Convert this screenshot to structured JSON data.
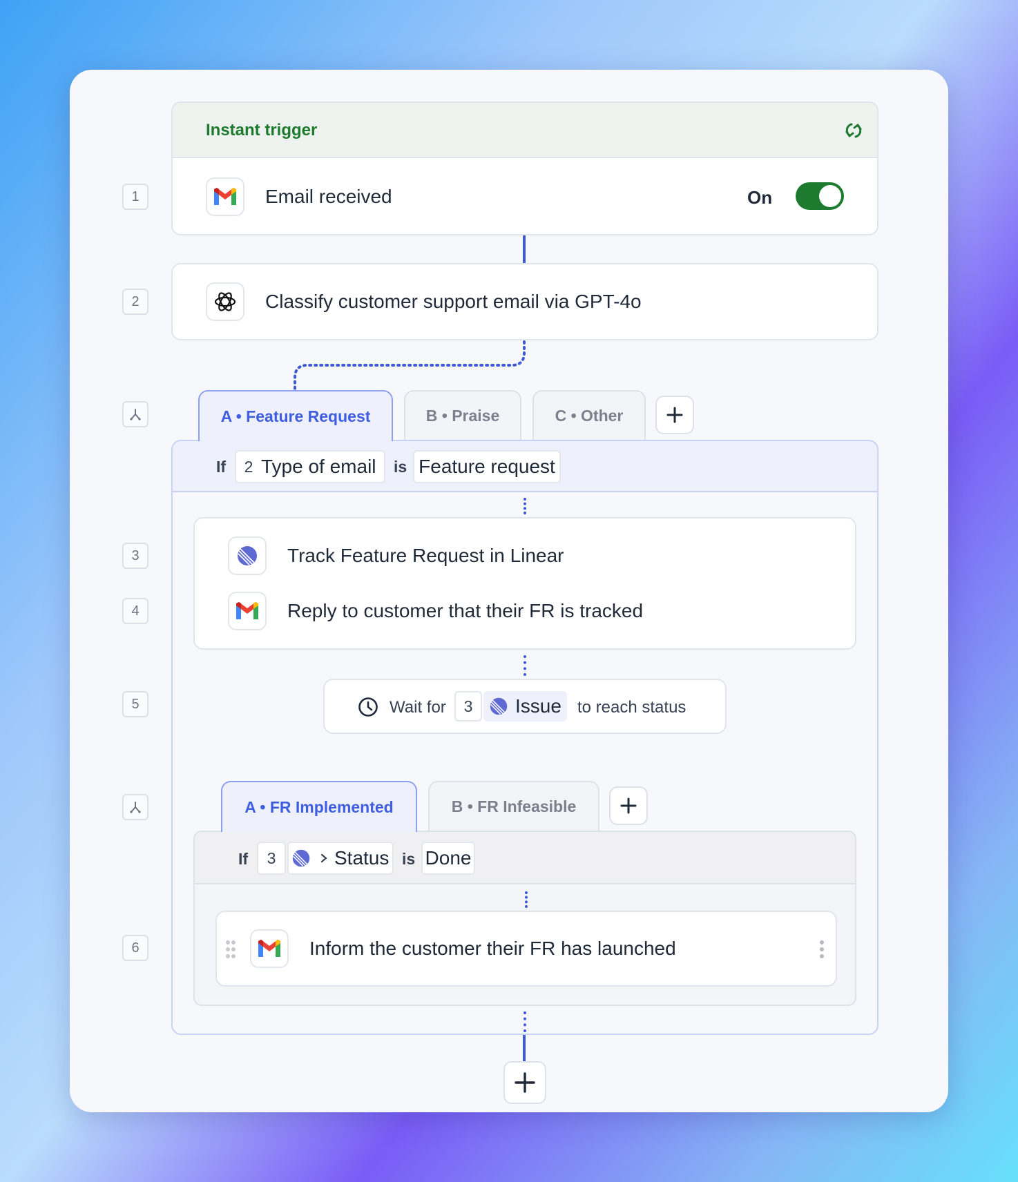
{
  "trigger": {
    "header": "Instant trigger",
    "step_number": "1",
    "label": "Email received",
    "toggle_label": "On",
    "toggle_on": true
  },
  "step2": {
    "number": "2",
    "label": "Classify customer support email via GPT-4o"
  },
  "branch1": {
    "tabs": [
      "A • Feature Request",
      "B • Praise",
      "C • Other"
    ],
    "condition": {
      "if": "If",
      "step_ref": "2",
      "field": "Type of email",
      "op": "is",
      "value": "Feature request"
    }
  },
  "step3": {
    "number": "3",
    "label": "Track Feature Request in Linear"
  },
  "step4": {
    "number": "4",
    "label": "Reply to customer that their FR is tracked"
  },
  "step5": {
    "number": "5",
    "prefix": "Wait for",
    "step_ref": "3",
    "object": "Issue",
    "suffix": "to reach status"
  },
  "branch2": {
    "tabs": [
      "A • FR Implemented",
      "B • FR Infeasible"
    ],
    "condition": {
      "if": "If",
      "step_ref": "3",
      "field": "Status",
      "op": "is",
      "value": "Done"
    }
  },
  "step6": {
    "number": "6",
    "label": "Inform the customer their FR has launched"
  },
  "colors": {
    "trigger_green": "#1e7a2e",
    "accent_blue": "#3f5ee0"
  }
}
